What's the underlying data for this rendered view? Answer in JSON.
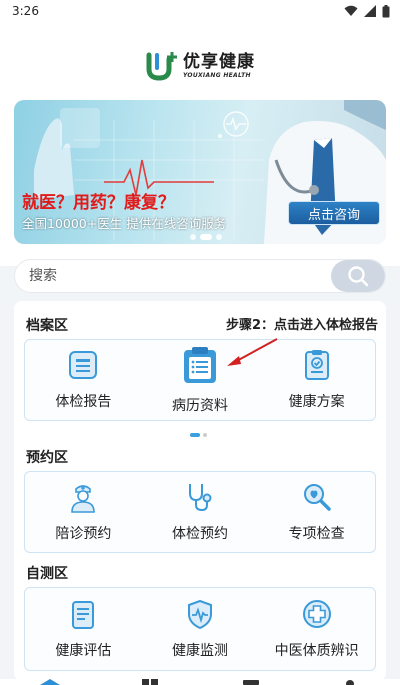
{
  "status_bar": {
    "time": "3:26"
  },
  "header": {
    "brand_cn": "优享健康",
    "brand_en": "YOUXIANG HEALTH"
  },
  "banner": {
    "headline": "就医？用药？康复？",
    "subline": "全国10000+医生   提供在线咨询服务",
    "cta_label": "点击咨询"
  },
  "search": {
    "placeholder": "搜索"
  },
  "archive": {
    "title": "档案区",
    "hint": "步骤2：点击进入体检报告",
    "items": [
      {
        "label": "体检报告",
        "icon": "clipboard-report-icon"
      },
      {
        "label": "病历资料",
        "icon": "medical-record-icon"
      },
      {
        "label": "健康方案",
        "icon": "health-plan-icon"
      }
    ]
  },
  "booking": {
    "title": "预约区",
    "items": [
      {
        "label": "陪诊预约",
        "icon": "nurse-icon"
      },
      {
        "label": "体检预约",
        "icon": "stethoscope-icon"
      },
      {
        "label": "专项检查",
        "icon": "magnifier-icon"
      }
    ]
  },
  "selftest": {
    "title": "自测区",
    "items": [
      {
        "label": "健康评估",
        "icon": "assessment-icon"
      },
      {
        "label": "健康监测",
        "icon": "shield-pulse-icon"
      },
      {
        "label": "中医体质辨识",
        "icon": "tcm-cross-icon"
      }
    ]
  },
  "colors": {
    "accent": "#2d8fd5",
    "icon_blue": "#3a9ad9",
    "highlight": "#e11b1b"
  }
}
